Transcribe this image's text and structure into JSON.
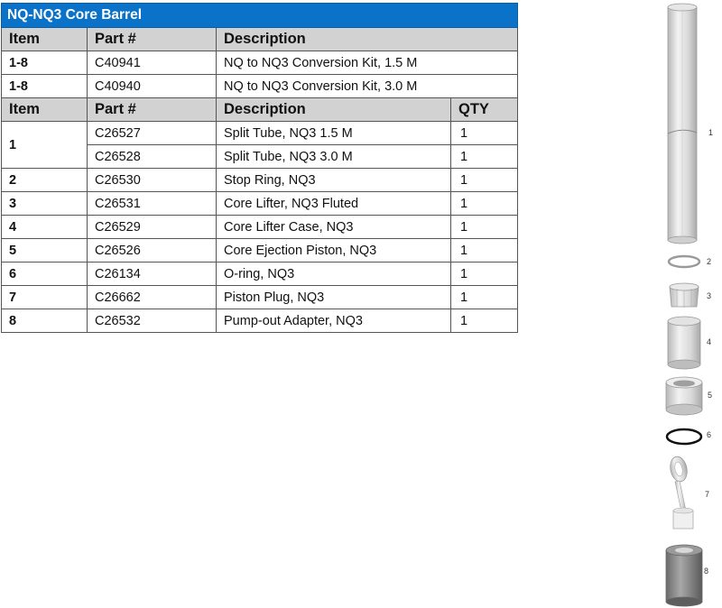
{
  "table": {
    "title": "NQ-NQ3 Core Barrel",
    "kit_header": {
      "item": "Item",
      "part": "Part #",
      "description": "Description"
    },
    "kits": [
      {
        "item": "1-8",
        "part": "C40941",
        "description": "NQ to NQ3 Conversion Kit, 1.5 M"
      },
      {
        "item": "1-8",
        "part": "C40940",
        "description": "NQ to NQ3 Conversion Kit, 3.0 M"
      }
    ],
    "parts_header": {
      "item": "Item",
      "part": "Part #",
      "description": "Description",
      "qty": "QTY"
    },
    "parts": [
      {
        "item": "1",
        "part": "C26527",
        "description": "Split Tube, NQ3 1.5 M",
        "qty": "1"
      },
      {
        "item": "",
        "part": "C26528",
        "description": "Split Tube, NQ3 3.0 M",
        "qty": "1"
      },
      {
        "item": "2",
        "part": "C26530",
        "description": "Stop Ring, NQ3",
        "qty": "1"
      },
      {
        "item": "3",
        "part": "C26531",
        "description": "Core Lifter, NQ3 Fluted",
        "qty": "1"
      },
      {
        "item": "4",
        "part": "C26529",
        "description": "Core Lifter Case, NQ3",
        "qty": "1"
      },
      {
        "item": "5",
        "part": "C26526",
        "description": "Core Ejection Piston, NQ3",
        "qty": "1"
      },
      {
        "item": "6",
        "part": "C26134",
        "description": "O-ring, NQ3",
        "qty": "1"
      },
      {
        "item": "7",
        "part": "C26662",
        "description": "Piston Plug, NQ3",
        "qty": "1"
      },
      {
        "item": "8",
        "part": "C26532",
        "description": "Pump-out Adapter, NQ3",
        "qty": "1"
      }
    ]
  },
  "drawing": {
    "callouts": [
      "1",
      "2",
      "3",
      "4",
      "5",
      "6",
      "7",
      "8"
    ]
  }
}
